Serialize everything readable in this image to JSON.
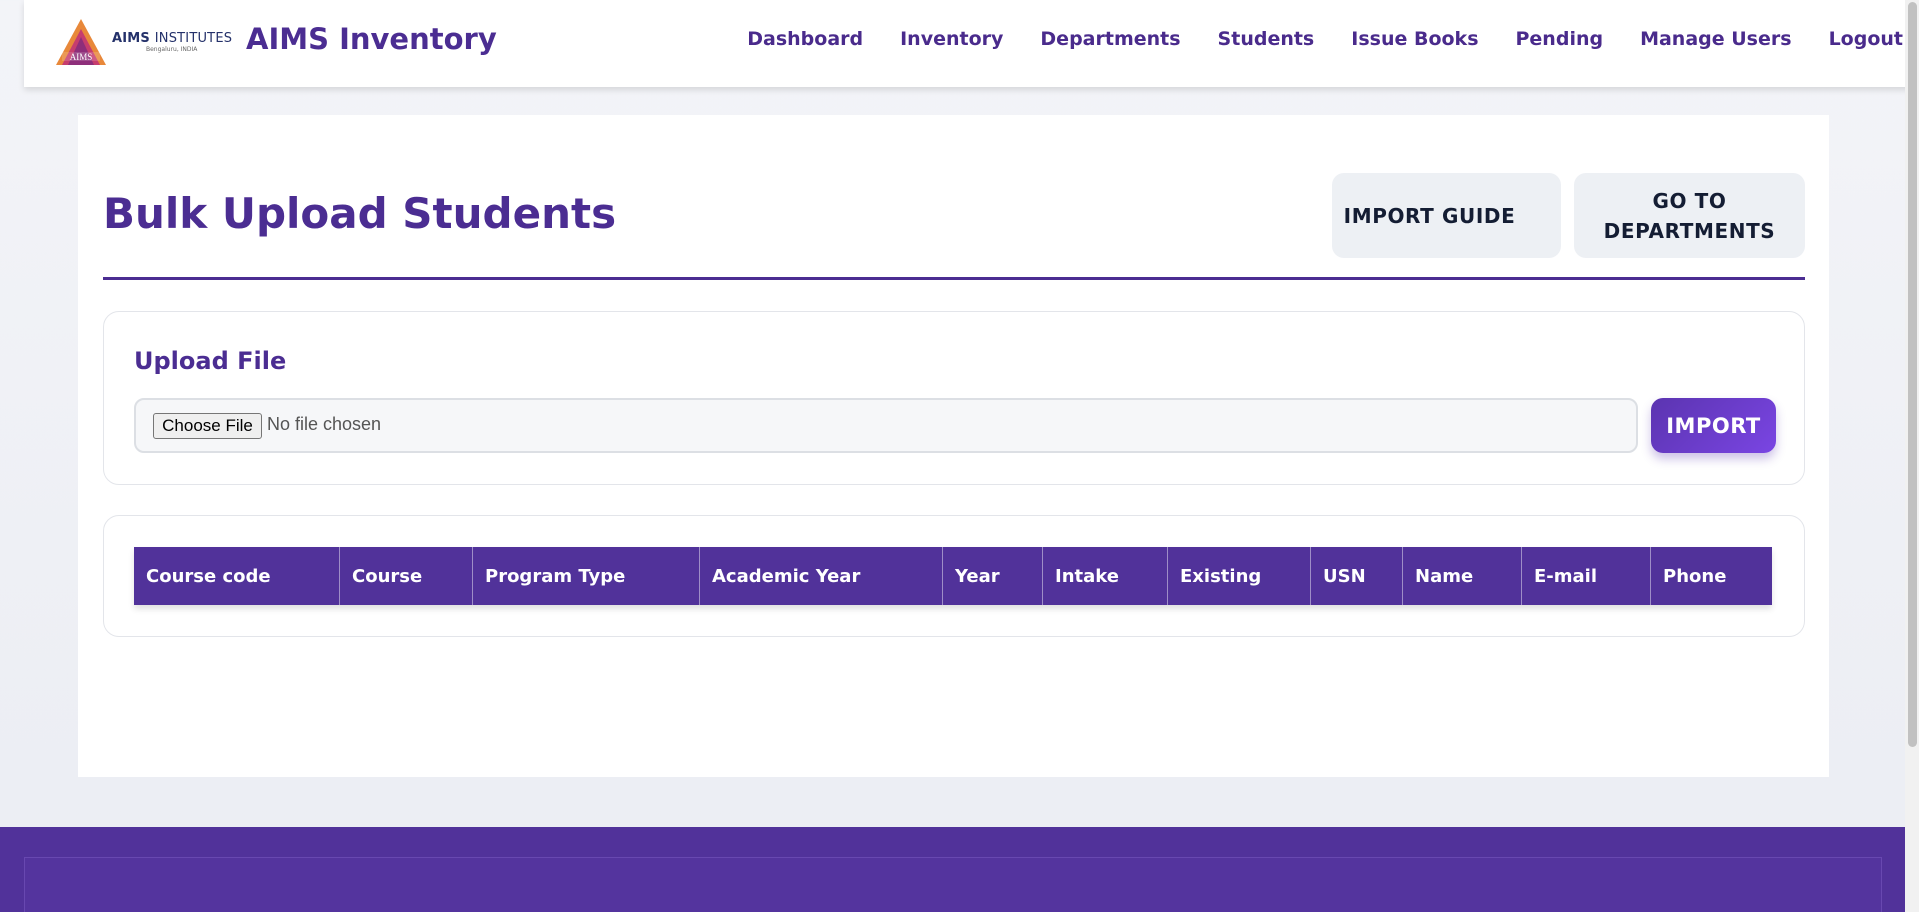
{
  "header": {
    "logo_line1_bold": "AIMS",
    "logo_line1_rest": "INSTITUTES",
    "logo_line2": "Bengaluru, INDIA",
    "logo_emblem_text": "AIMS",
    "brand_title": "AIMS Inventory",
    "nav": [
      "Dashboard",
      "Inventory",
      "Departments",
      "Students",
      "Issue Books",
      "Pending",
      "Manage Users",
      "Logout"
    ]
  },
  "page": {
    "title": "Bulk Upload Students",
    "import_guide_label": "IMPORT GUIDE",
    "go_to_departments_label": "GO TO DEPARTMENTS"
  },
  "upload": {
    "title": "Upload File",
    "choose_file_label": "Choose File",
    "file_status": "No file chosen",
    "import_label": "IMPORT"
  },
  "table": {
    "columns": [
      "Course code",
      "Course",
      "Program Type",
      "Academic Year",
      "Year",
      "Intake",
      "Existing",
      "USN",
      "Name",
      "E-mail",
      "Phone"
    ]
  },
  "colors": {
    "brand_purple": "#4b2d92",
    "table_header": "#51329a",
    "import_gradient_start": "#5b34b0",
    "import_gradient_end": "#7a45e3"
  }
}
